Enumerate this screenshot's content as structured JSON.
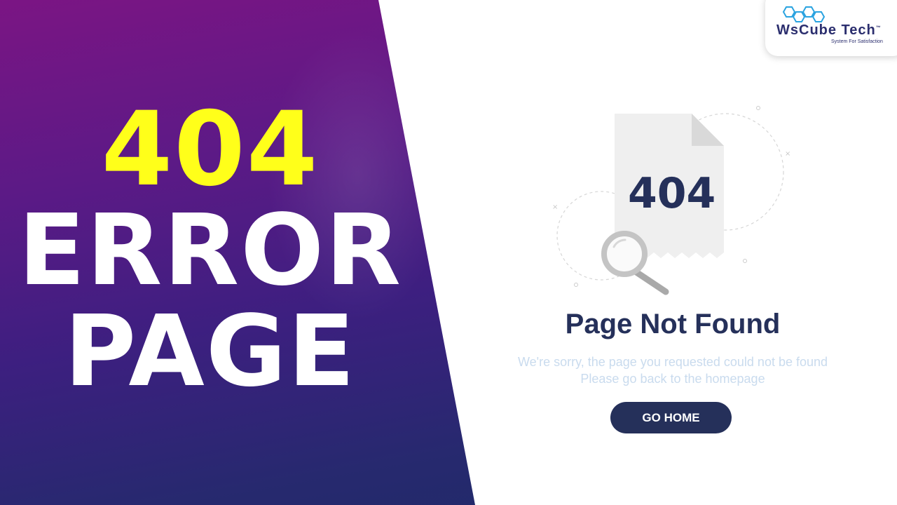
{
  "headline": {
    "code": "404",
    "line2": "ERROR",
    "line3": "PAGE"
  },
  "logo": {
    "name": "WsCube Tech",
    "trademark": "™",
    "tagline": "System For Satisfaction"
  },
  "illustration": {
    "document_code": "404",
    "icons": [
      "document-icon",
      "magnifier-icon"
    ]
  },
  "message": {
    "title": "Page Not Found",
    "line1": "We're sorry, the page you requested could not be found",
    "line2": "Please go back to the homepage"
  },
  "actions": {
    "go_home_label": "GO HOME"
  },
  "colors": {
    "headline_accent": "#ffff1a",
    "navy": "#25305a",
    "left_gradient_top": "#7b1584",
    "left_gradient_bottom": "#1d2a66",
    "subtext": "#c9dbee",
    "logo_accent": "#2aa3e0"
  }
}
